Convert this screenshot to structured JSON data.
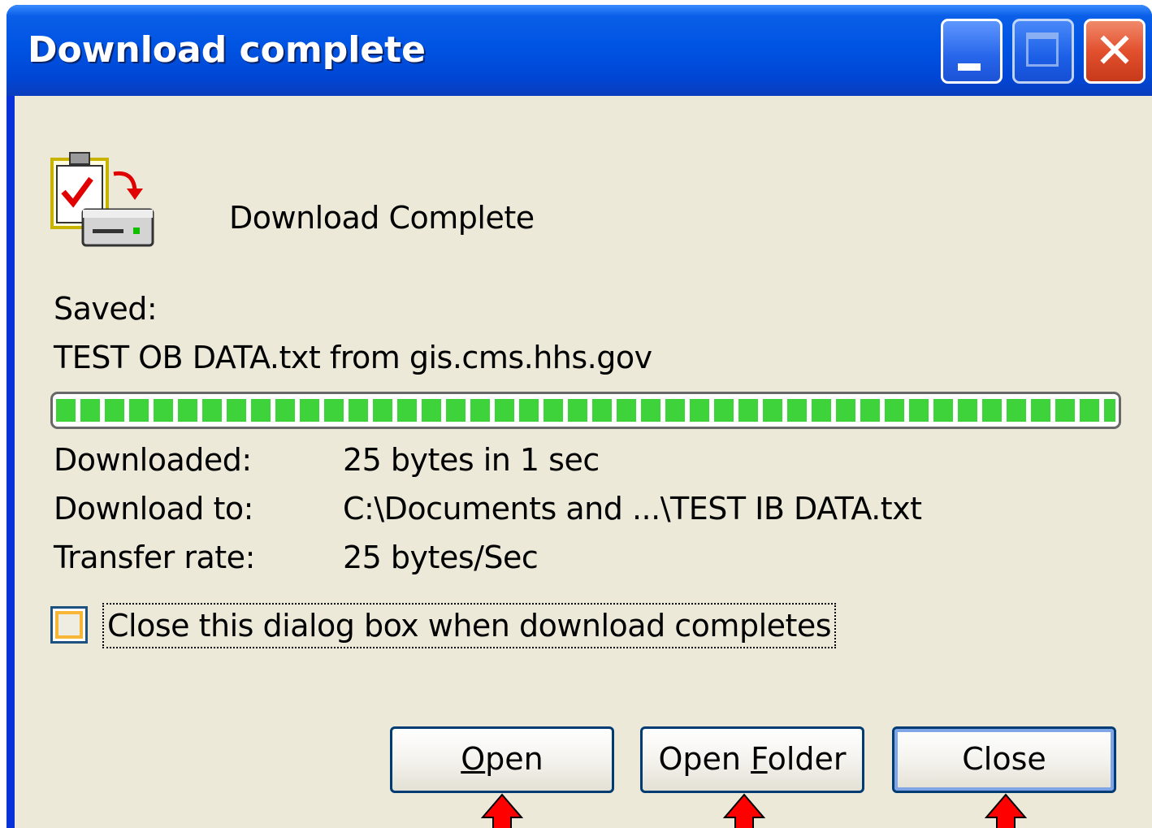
{
  "window": {
    "title": "Download complete"
  },
  "status": {
    "heading": "Download Complete"
  },
  "saved": {
    "label": "Saved:",
    "file": "TEST OB DATA.txt from gis.cms.hhs.gov"
  },
  "progress": {
    "fraction": 1.0,
    "color": "#3ed33a"
  },
  "details": {
    "downloaded_label": "Downloaded:",
    "downloaded_value": "25 bytes in 1 sec",
    "download_to_label": "Download to:",
    "download_to_value": "C:\\Documents and ...\\TEST IB DATA.txt",
    "transfer_rate_label": "Transfer rate:",
    "transfer_rate_value": "25 bytes/Sec"
  },
  "options": {
    "close_when_done_label": "Close this dialog box when download completes",
    "close_when_done_checked": false
  },
  "buttons": {
    "open_prefix": "O",
    "open_rest": "pen",
    "open_folder_prefix": "Open ",
    "open_folder_mnemonic": "F",
    "open_folder_rest": "older",
    "close": "Close"
  },
  "icons": {
    "title_minimize": "minimize-icon",
    "title_maximize": "maximize-icon",
    "title_close": "close-icon",
    "main": "download-complete-icon",
    "pointer": "red-arrow-icon"
  },
  "colors": {
    "titlebar": "#0054e3",
    "client_bg": "#ece9d8",
    "arrow": "#ff0000"
  }
}
